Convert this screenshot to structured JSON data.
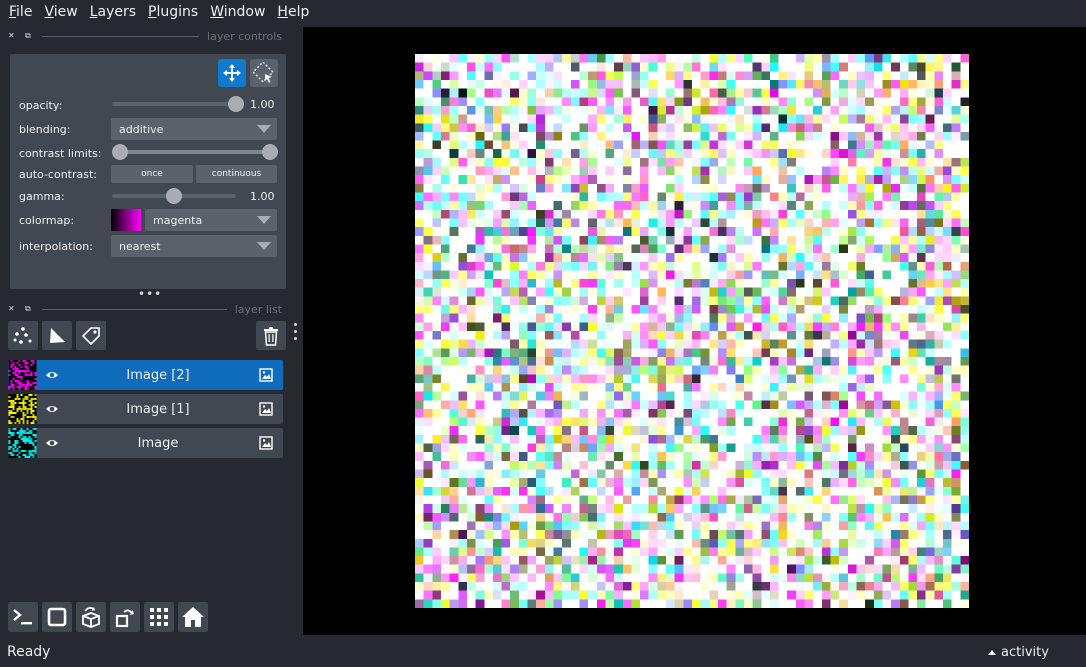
{
  "menu": [
    {
      "label": "File",
      "key": "F",
      "rest": "ile"
    },
    {
      "label": "View",
      "key": "V",
      "rest": "iew"
    },
    {
      "label": "Layers",
      "key": "L",
      "rest": "ayers"
    },
    {
      "label": "Plugins",
      "key": "P",
      "rest": "lugins"
    },
    {
      "label": "Window",
      "key": "W",
      "rest": "indow"
    },
    {
      "label": "Help",
      "key": "H",
      "rest": "elp"
    }
  ],
  "layer_controls": {
    "title": "layer controls",
    "opacity_label": "opacity:",
    "opacity_value": "1.00",
    "opacity_fraction": 1.0,
    "blending_label": "blending:",
    "blending_value": "additive",
    "contrast_label": "contrast limits:",
    "auto_contrast_label": "auto-contrast:",
    "once_label": "once",
    "continuous_label": "continuous",
    "gamma_label": "gamma:",
    "gamma_value": "1.00",
    "gamma_fraction": 0.5,
    "colormap_label": "colormap:",
    "colormap_value": "magenta",
    "interpolation_label": "interpolation:",
    "interpolation_value": "nearest"
  },
  "layer_list": {
    "title": "layer list",
    "layers": [
      {
        "name": "Image [2]",
        "colormap": "magenta",
        "color": "#ff00ff",
        "selected": true
      },
      {
        "name": "Image [1]",
        "colormap": "yellow",
        "color": "#ffff00",
        "selected": false
      },
      {
        "name": "Image",
        "colormap": "cyan",
        "color": "#00ffff",
        "selected": false
      }
    ]
  },
  "status": {
    "text": "Ready",
    "activity": "activity"
  },
  "colors": {
    "background": "#262930",
    "panel": "#414851",
    "accent": "#0f6cbd",
    "canvas": "#000000"
  }
}
